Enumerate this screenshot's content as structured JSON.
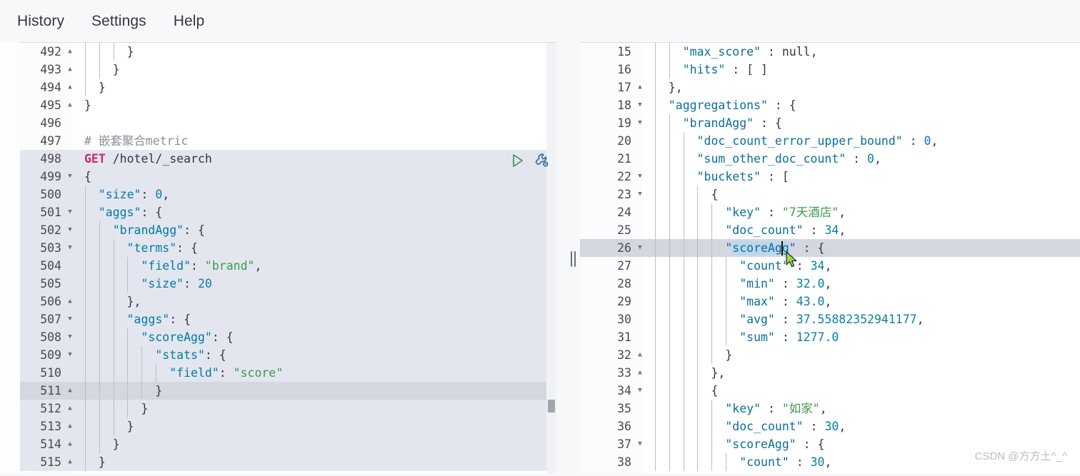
{
  "menubar": {
    "items": [
      {
        "label": "History",
        "name": "menu-history"
      },
      {
        "label": "Settings",
        "name": "menu-settings"
      },
      {
        "label": "Help",
        "name": "menu-help"
      }
    ]
  },
  "colors": {
    "accent_key": "#0079a5",
    "accent_string": "#3c9a50",
    "accent_method": "#cc2a6a",
    "comment": "#8a8f98",
    "active_line": "#d4d7e0",
    "selection": "#e3e6ee",
    "page_bg": "#f7f8fa",
    "editor_bg": "#ffffff"
  },
  "request_editor": {
    "name": "request-editor",
    "first_line_number": 492,
    "active_line": 511,
    "selected_lines": [
      498,
      499,
      500,
      501,
      502,
      503,
      504,
      505,
      506,
      507,
      508,
      509,
      510,
      511,
      512,
      513,
      514,
      515
    ],
    "play_button_label": "Send request",
    "wrench_button_label": "Open documentation / auto indent",
    "lines": [
      {
        "n": 492,
        "fold": "up",
        "text": "      }"
      },
      {
        "n": 493,
        "fold": "up",
        "text": "    }"
      },
      {
        "n": 494,
        "fold": "up",
        "text": "  }"
      },
      {
        "n": 495,
        "fold": "up",
        "text": "}"
      },
      {
        "n": 496,
        "fold": "",
        "text": ""
      },
      {
        "n": 497,
        "fold": "",
        "text": "# 嵌套聚合metric"
      },
      {
        "n": 498,
        "fold": "",
        "text": "GET /hotel/_search"
      },
      {
        "n": 499,
        "fold": "down",
        "text": "{"
      },
      {
        "n": 500,
        "fold": "",
        "text": "  \"size\": 0,"
      },
      {
        "n": 501,
        "fold": "down",
        "text": "  \"aggs\": {"
      },
      {
        "n": 502,
        "fold": "down",
        "text": "    \"brandAgg\": {"
      },
      {
        "n": 503,
        "fold": "down",
        "text": "      \"terms\": {"
      },
      {
        "n": 504,
        "fold": "",
        "text": "        \"field\": \"brand\","
      },
      {
        "n": 505,
        "fold": "",
        "text": "        \"size\": 20"
      },
      {
        "n": 506,
        "fold": "up",
        "text": "      },"
      },
      {
        "n": 507,
        "fold": "down",
        "text": "      \"aggs\": {"
      },
      {
        "n": 508,
        "fold": "down",
        "text": "        \"scoreAgg\": {"
      },
      {
        "n": 509,
        "fold": "down",
        "text": "          \"stats\": {"
      },
      {
        "n": 510,
        "fold": "",
        "text": "            \"field\": \"score\""
      },
      {
        "n": 511,
        "fold": "up",
        "text": "          }"
      },
      {
        "n": 512,
        "fold": "up",
        "text": "        }"
      },
      {
        "n": 513,
        "fold": "up",
        "text": "      }"
      },
      {
        "n": 514,
        "fold": "up",
        "text": "    }"
      },
      {
        "n": 515,
        "fold": "up",
        "text": "  }"
      }
    ]
  },
  "response_editor": {
    "name": "response-editor",
    "first_line_number": 15,
    "active_line": 26,
    "selected_word": "scoreAgg",
    "lines": [
      {
        "n": 15,
        "fold": "",
        "text": "    \"max_score\" : null,"
      },
      {
        "n": 16,
        "fold": "",
        "text": "    \"hits\" : [ ]"
      },
      {
        "n": 17,
        "fold": "up",
        "text": "  },"
      },
      {
        "n": 18,
        "fold": "down",
        "text": "  \"aggregations\" : {"
      },
      {
        "n": 19,
        "fold": "down",
        "text": "    \"brandAgg\" : {"
      },
      {
        "n": 20,
        "fold": "",
        "text": "      \"doc_count_error_upper_bound\" : 0,"
      },
      {
        "n": 21,
        "fold": "",
        "text": "      \"sum_other_doc_count\" : 0,"
      },
      {
        "n": 22,
        "fold": "down",
        "text": "      \"buckets\" : ["
      },
      {
        "n": 23,
        "fold": "down",
        "text": "        {"
      },
      {
        "n": 24,
        "fold": "",
        "text": "          \"key\" : \"7天酒店\","
      },
      {
        "n": 25,
        "fold": "",
        "text": "          \"doc_count\" : 34,"
      },
      {
        "n": 26,
        "fold": "down",
        "text": "          \"scoreAgg\" : {"
      },
      {
        "n": 27,
        "fold": "",
        "text": "            \"count\" : 34,"
      },
      {
        "n": 28,
        "fold": "",
        "text": "            \"min\" : 32.0,"
      },
      {
        "n": 29,
        "fold": "",
        "text": "            \"max\" : 43.0,"
      },
      {
        "n": 30,
        "fold": "",
        "text": "            \"avg\" : 37.55882352941177,"
      },
      {
        "n": 31,
        "fold": "",
        "text": "            \"sum\" : 1277.0"
      },
      {
        "n": 32,
        "fold": "up",
        "text": "          }"
      },
      {
        "n": 33,
        "fold": "up",
        "text": "        },"
      },
      {
        "n": 34,
        "fold": "down",
        "text": "        {"
      },
      {
        "n": 35,
        "fold": "",
        "text": "          \"key\" : \"如家\","
      },
      {
        "n": 36,
        "fold": "",
        "text": "          \"doc_count\" : 30,"
      },
      {
        "n": 37,
        "fold": "down",
        "text": "          \"scoreAgg\" : {"
      },
      {
        "n": 38,
        "fold": "",
        "text": "            \"count\" : 30,"
      }
    ]
  },
  "splitter": {
    "name": "pane-splitter",
    "label": "Resize panes"
  },
  "watermark": {
    "text": "CSDN @方方土^_^"
  }
}
